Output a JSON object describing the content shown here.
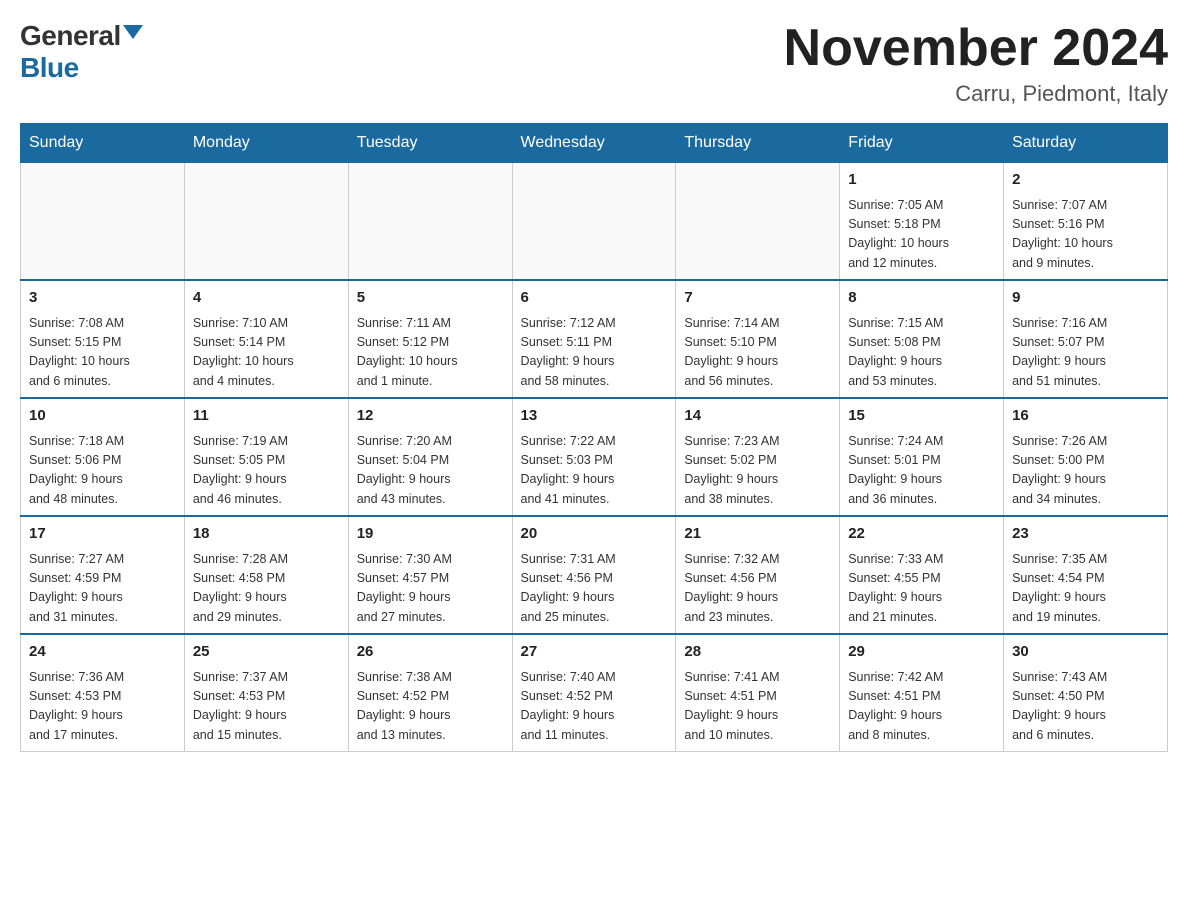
{
  "header": {
    "logo_general": "General",
    "logo_blue": "Blue",
    "month_title": "November 2024",
    "location": "Carru, Piedmont, Italy"
  },
  "weekdays": [
    "Sunday",
    "Monday",
    "Tuesday",
    "Wednesday",
    "Thursday",
    "Friday",
    "Saturday"
  ],
  "weeks": [
    [
      {
        "day": "",
        "info": ""
      },
      {
        "day": "",
        "info": ""
      },
      {
        "day": "",
        "info": ""
      },
      {
        "day": "",
        "info": ""
      },
      {
        "day": "",
        "info": ""
      },
      {
        "day": "1",
        "info": "Sunrise: 7:05 AM\nSunset: 5:18 PM\nDaylight: 10 hours\nand 12 minutes."
      },
      {
        "day": "2",
        "info": "Sunrise: 7:07 AM\nSunset: 5:16 PM\nDaylight: 10 hours\nand 9 minutes."
      }
    ],
    [
      {
        "day": "3",
        "info": "Sunrise: 7:08 AM\nSunset: 5:15 PM\nDaylight: 10 hours\nand 6 minutes."
      },
      {
        "day": "4",
        "info": "Sunrise: 7:10 AM\nSunset: 5:14 PM\nDaylight: 10 hours\nand 4 minutes."
      },
      {
        "day": "5",
        "info": "Sunrise: 7:11 AM\nSunset: 5:12 PM\nDaylight: 10 hours\nand 1 minute."
      },
      {
        "day": "6",
        "info": "Sunrise: 7:12 AM\nSunset: 5:11 PM\nDaylight: 9 hours\nand 58 minutes."
      },
      {
        "day": "7",
        "info": "Sunrise: 7:14 AM\nSunset: 5:10 PM\nDaylight: 9 hours\nand 56 minutes."
      },
      {
        "day": "8",
        "info": "Sunrise: 7:15 AM\nSunset: 5:08 PM\nDaylight: 9 hours\nand 53 minutes."
      },
      {
        "day": "9",
        "info": "Sunrise: 7:16 AM\nSunset: 5:07 PM\nDaylight: 9 hours\nand 51 minutes."
      }
    ],
    [
      {
        "day": "10",
        "info": "Sunrise: 7:18 AM\nSunset: 5:06 PM\nDaylight: 9 hours\nand 48 minutes."
      },
      {
        "day": "11",
        "info": "Sunrise: 7:19 AM\nSunset: 5:05 PM\nDaylight: 9 hours\nand 46 minutes."
      },
      {
        "day": "12",
        "info": "Sunrise: 7:20 AM\nSunset: 5:04 PM\nDaylight: 9 hours\nand 43 minutes."
      },
      {
        "day": "13",
        "info": "Sunrise: 7:22 AM\nSunset: 5:03 PM\nDaylight: 9 hours\nand 41 minutes."
      },
      {
        "day": "14",
        "info": "Sunrise: 7:23 AM\nSunset: 5:02 PM\nDaylight: 9 hours\nand 38 minutes."
      },
      {
        "day": "15",
        "info": "Sunrise: 7:24 AM\nSunset: 5:01 PM\nDaylight: 9 hours\nand 36 minutes."
      },
      {
        "day": "16",
        "info": "Sunrise: 7:26 AM\nSunset: 5:00 PM\nDaylight: 9 hours\nand 34 minutes."
      }
    ],
    [
      {
        "day": "17",
        "info": "Sunrise: 7:27 AM\nSunset: 4:59 PM\nDaylight: 9 hours\nand 31 minutes."
      },
      {
        "day": "18",
        "info": "Sunrise: 7:28 AM\nSunset: 4:58 PM\nDaylight: 9 hours\nand 29 minutes."
      },
      {
        "day": "19",
        "info": "Sunrise: 7:30 AM\nSunset: 4:57 PM\nDaylight: 9 hours\nand 27 minutes."
      },
      {
        "day": "20",
        "info": "Sunrise: 7:31 AM\nSunset: 4:56 PM\nDaylight: 9 hours\nand 25 minutes."
      },
      {
        "day": "21",
        "info": "Sunrise: 7:32 AM\nSunset: 4:56 PM\nDaylight: 9 hours\nand 23 minutes."
      },
      {
        "day": "22",
        "info": "Sunrise: 7:33 AM\nSunset: 4:55 PM\nDaylight: 9 hours\nand 21 minutes."
      },
      {
        "day": "23",
        "info": "Sunrise: 7:35 AM\nSunset: 4:54 PM\nDaylight: 9 hours\nand 19 minutes."
      }
    ],
    [
      {
        "day": "24",
        "info": "Sunrise: 7:36 AM\nSunset: 4:53 PM\nDaylight: 9 hours\nand 17 minutes."
      },
      {
        "day": "25",
        "info": "Sunrise: 7:37 AM\nSunset: 4:53 PM\nDaylight: 9 hours\nand 15 minutes."
      },
      {
        "day": "26",
        "info": "Sunrise: 7:38 AM\nSunset: 4:52 PM\nDaylight: 9 hours\nand 13 minutes."
      },
      {
        "day": "27",
        "info": "Sunrise: 7:40 AM\nSunset: 4:52 PM\nDaylight: 9 hours\nand 11 minutes."
      },
      {
        "day": "28",
        "info": "Sunrise: 7:41 AM\nSunset: 4:51 PM\nDaylight: 9 hours\nand 10 minutes."
      },
      {
        "day": "29",
        "info": "Sunrise: 7:42 AM\nSunset: 4:51 PM\nDaylight: 9 hours\nand 8 minutes."
      },
      {
        "day": "30",
        "info": "Sunrise: 7:43 AM\nSunset: 4:50 PM\nDaylight: 9 hours\nand 6 minutes."
      }
    ]
  ]
}
